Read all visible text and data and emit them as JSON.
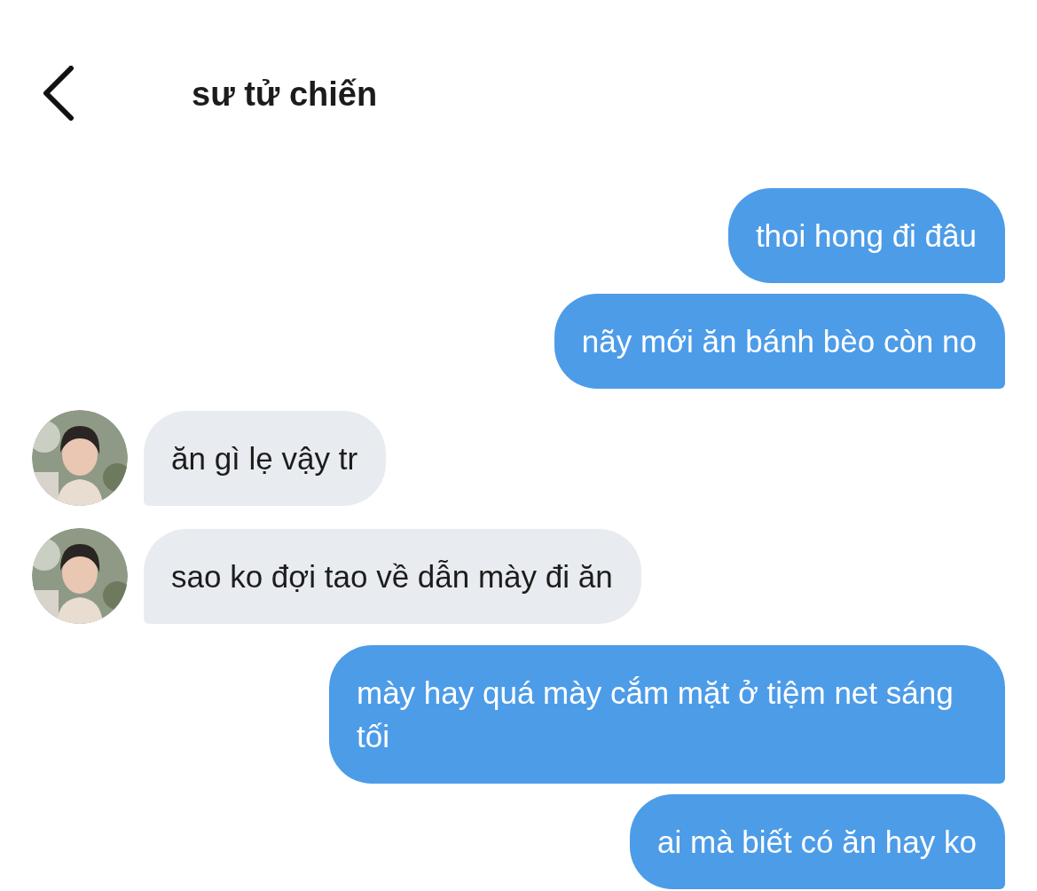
{
  "header": {
    "title": "sư tử chiến"
  },
  "messages": [
    {
      "kind": "sent",
      "text": "thoi hong đi đâu"
    },
    {
      "kind": "sent",
      "text": "nãy mới ăn bánh bèo còn no"
    },
    {
      "kind": "received",
      "text": "ăn gì lẹ vậy tr"
    },
    {
      "kind": "received",
      "text": "sao ko đợi tao về dẫn mày đi ăn"
    },
    {
      "kind": "sent",
      "text": "mày hay quá mày cắm mặt ở tiệm net sáng tối"
    },
    {
      "kind": "sent",
      "text": "ai mà biết có ăn hay ko"
    }
  ]
}
